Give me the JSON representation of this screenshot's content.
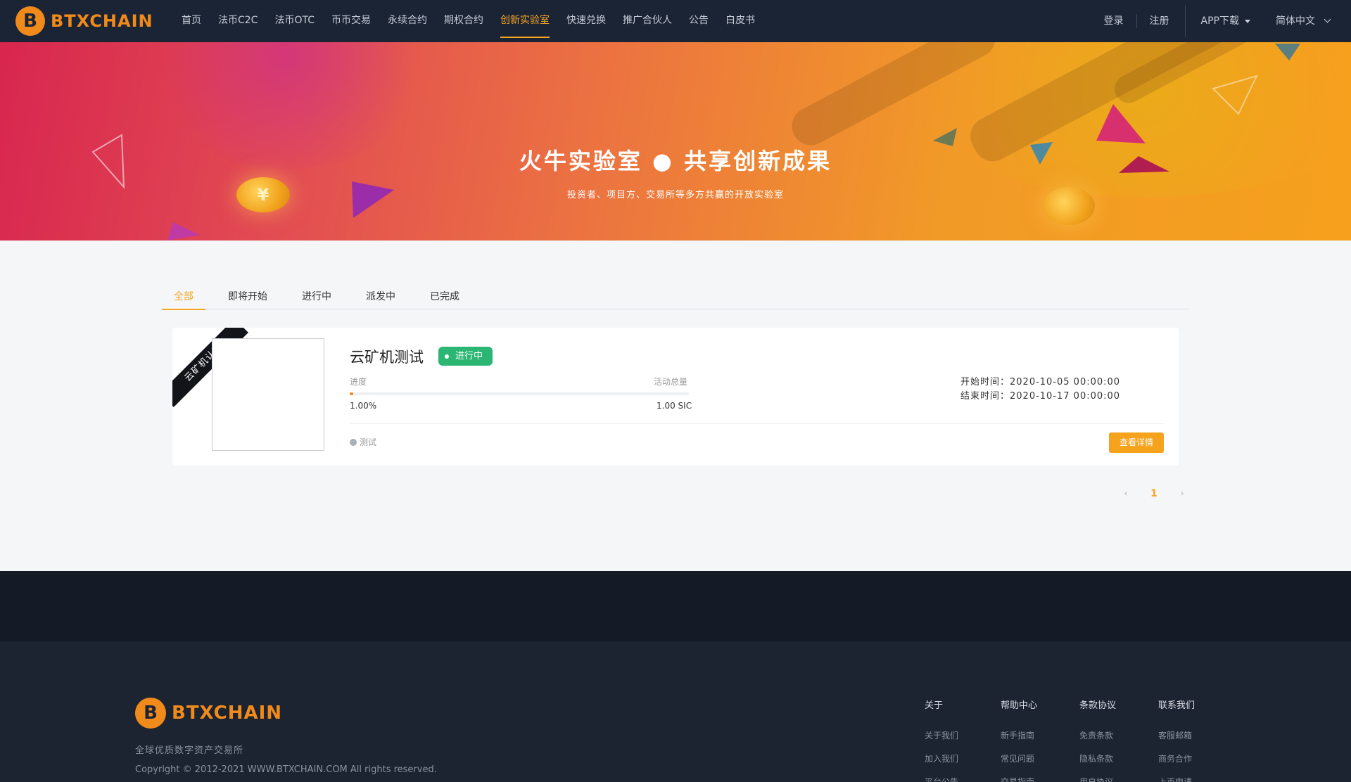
{
  "brand": {
    "logo_glyph": "B",
    "logo_text": "BTXCHAIN",
    "accent": "#f6a623",
    "orange": "#f08a1b"
  },
  "nav": {
    "links": [
      "首页",
      "法币C2C",
      "法币OTC",
      "币币交易",
      "永续合约",
      "期权合约",
      "创新实验室",
      "快速兑换",
      "推广合伙人",
      "公告",
      "白皮书"
    ],
    "login": "登录",
    "register": "注册",
    "app_download": "APP下载",
    "language": "简体中文"
  },
  "banner": {
    "title": "火牛实验室 ● 共享创新成果",
    "subtitle": "投资者、项目方、交易所等多方共赢的开放实验室",
    "coin_symbol": "¥"
  },
  "tabs": [
    "全部",
    "即将开始",
    "进行中",
    "派发中",
    "已完成"
  ],
  "project": {
    "ribbon": "云矿机认购",
    "title": "云矿机测试",
    "status": "进行中",
    "status_color": "#2bb673",
    "progress_label": "进度",
    "total_label": "活动总量",
    "progress_text": "1.00%",
    "progress_value": 0.01,
    "total_value": "1.00 SIC",
    "start_time": "开始时间：2020-10-05 00:00:00",
    "end_time": "结束时间：2020-10-17 00:00:00",
    "tag": "测试",
    "detail_button": "查看详情"
  },
  "pagination": {
    "prev": "‹",
    "current": "1",
    "next": "›"
  },
  "footer": {
    "logo_text": "BTXCHAIN",
    "slogan": "全球优质数字资产交易所",
    "copyright": "Copyright © 2012-2021 WWW.BTXCHAIN.COM All rights reserved.",
    "columns": [
      {
        "title": "关于",
        "links": [
          "关于我们",
          "加入我们",
          "平台公告"
        ]
      },
      {
        "title": "帮助中心",
        "links": [
          "新手指南",
          "常见问题",
          "交易指南"
        ]
      },
      {
        "title": "条款协议",
        "links": [
          "免责条款",
          "隐私条款",
          "用户协议"
        ]
      },
      {
        "title": "联系我们",
        "links": [
          "客服邮箱",
          "商务合作",
          "上币申请"
        ]
      }
    ]
  }
}
